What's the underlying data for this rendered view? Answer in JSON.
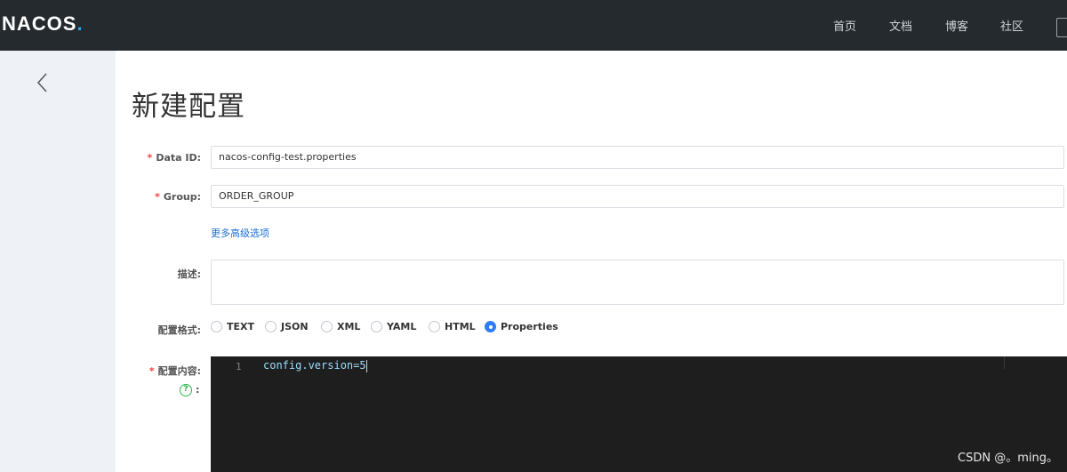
{
  "header": {
    "logo_text": "NACOS",
    "logo_dot": ".",
    "nav": [
      "首页",
      "文档",
      "博客",
      "社区"
    ]
  },
  "page": {
    "title": "新建配置"
  },
  "form": {
    "data_id": {
      "label": "Data ID:",
      "value": "nacos-config-test.properties"
    },
    "group": {
      "label": "Group:",
      "value": "ORDER_GROUP"
    },
    "advanced_link": "更多高级选项",
    "description": {
      "label": "描述:",
      "value": ""
    },
    "format": {
      "label": "配置格式:",
      "options": [
        "TEXT",
        "JSON",
        "XML",
        "YAML",
        "HTML",
        "Properties"
      ],
      "selected": "Properties"
    },
    "content": {
      "label": "配置内容:",
      "help_glyph": "?",
      "colon": ":",
      "line_number": "1",
      "code": "config.version=5"
    },
    "required_mark": "*"
  },
  "watermark": "CSDN @。ming。",
  "colors": {
    "topbar": "#252a2f",
    "accent": "#2f7cf6",
    "link": "#1b6fd6",
    "required": "#ff3d3d",
    "editor_bg": "#1e1e1e"
  }
}
